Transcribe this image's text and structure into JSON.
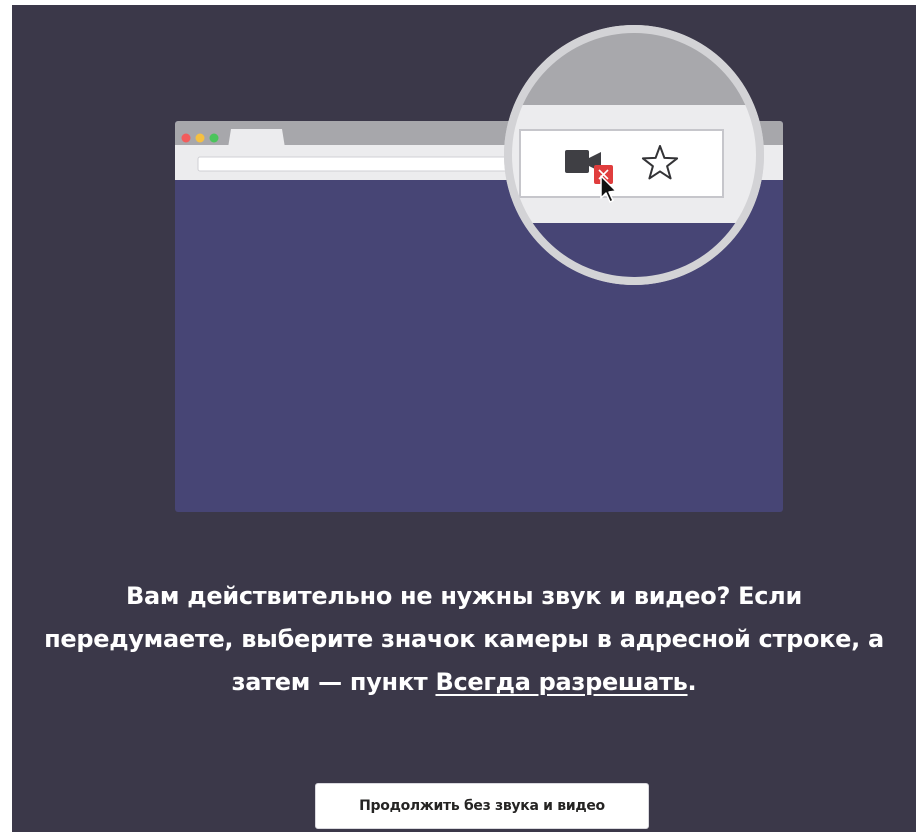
{
  "message": {
    "text_before_link": "Вам действительно не нужны звук и видео? Если передумаете, выберите значок камеры в адресной строке, а затем — пункт ",
    "link_label": "Всегда разрешать",
    "text_after_link": "."
  },
  "continue_button": {
    "label": "Продолжить без звука и видео"
  },
  "illustration": {
    "camera_icon": "video-camera-icon",
    "blocked_badge_icon": "blocked-x-icon",
    "bookmark_icon": "star-outline-icon",
    "cursor_icon": "mouse-pointer-icon"
  },
  "colors": {
    "panel_background": "#3b3849",
    "browser_content": "#474575",
    "blocked_badge": "#e03d3d",
    "traffic_red": "#f25c5c",
    "traffic_yellow": "#f5c042",
    "traffic_green": "#4bc45c"
  }
}
